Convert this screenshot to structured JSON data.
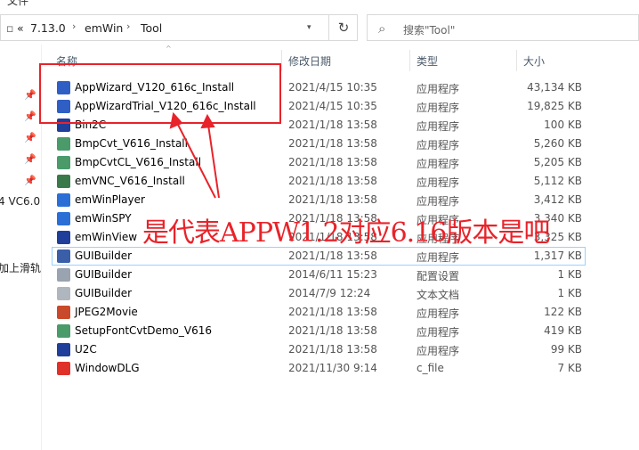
{
  "top_cut_text": "文件",
  "address": {
    "back_marker": "«",
    "crumbs": [
      "7.13.0",
      "emWin",
      "Tool"
    ],
    "refresh_icon": "refresh-icon"
  },
  "search": {
    "placeholder": "搜索\"Tool\""
  },
  "nav": {
    "items": [
      "4 VC6.0",
      "加上滑轨"
    ]
  },
  "columns": {
    "name": "名称",
    "date": "修改日期",
    "type": "类型",
    "size": "大小"
  },
  "files": [
    {
      "name": "AppWizard_V120_616c_Install",
      "date": "2021/4/15 10:35",
      "type": "应用程序",
      "size": "43,134 KB",
      "icon": "appwizard-icon",
      "color": "#2f5fc4"
    },
    {
      "name": "AppWizardTrial_V120_616c_Install",
      "date": "2021/4/15 10:35",
      "type": "应用程序",
      "size": "19,825 KB",
      "icon": "appwizard-icon",
      "color": "#2f5fc4"
    },
    {
      "name": "Bin2C",
      "date": "2021/1/18 13:58",
      "type": "应用程序",
      "size": "100 KB",
      "icon": "bin2c-icon",
      "color": "#1f3f9a"
    },
    {
      "name": "BmpCvt_V616_Install",
      "date": "2021/1/18 13:58",
      "type": "应用程序",
      "size": "5,260 KB",
      "icon": "installer-icon",
      "color": "#4a9a6a"
    },
    {
      "name": "BmpCvtCL_V616_Install",
      "date": "2021/1/18 13:58",
      "type": "应用程序",
      "size": "5,205 KB",
      "icon": "installer-icon",
      "color": "#4a9a6a"
    },
    {
      "name": "emVNC_V616_Install",
      "date": "2021/1/18 13:58",
      "type": "应用程序",
      "size": "5,112 KB",
      "icon": "installer-icon",
      "color": "#3a7a4a"
    },
    {
      "name": "emWinPlayer",
      "date": "2021/1/18 13:58",
      "type": "应用程序",
      "size": "3,412 KB",
      "icon": "player-icon",
      "color": "#2b6fd6"
    },
    {
      "name": "emWinSPY",
      "date": "2021/1/18 13:58",
      "type": "应用程序",
      "size": "3,340 KB",
      "icon": "spy-icon",
      "color": "#2b6fd6"
    },
    {
      "name": "emWinView",
      "date": "2021/1/18 13:58",
      "type": "应用程序",
      "size": "3,325 KB",
      "icon": "view-icon",
      "color": "#1f3f9a"
    },
    {
      "name": "GUIBuilder",
      "date": "2021/1/18 13:58",
      "type": "应用程序",
      "size": "1,317 KB",
      "icon": "guibuilder-icon",
      "color": "#3a5fa8",
      "selected": true
    },
    {
      "name": "GUIBuilder",
      "date": "2014/6/11 15:23",
      "type": "配置设置",
      "size": "1 KB",
      "icon": "config-file-icon",
      "color": "#9aa4b0"
    },
    {
      "name": "GUIBuilder",
      "date": "2014/7/9 12:24",
      "type": "文本文档",
      "size": "1 KB",
      "icon": "text-file-icon",
      "color": "#b0b6bd"
    },
    {
      "name": "JPEG2Movie",
      "date": "2021/1/18 13:58",
      "type": "应用程序",
      "size": "122 KB",
      "icon": "jpeg2movie-icon",
      "color": "#c94a2a"
    },
    {
      "name": "SetupFontCvtDemo_V616",
      "date": "2021/1/18 13:58",
      "type": "应用程序",
      "size": "419 KB",
      "icon": "installer-icon",
      "color": "#4a9a6a"
    },
    {
      "name": "U2C",
      "date": "2021/1/18 13:58",
      "type": "应用程序",
      "size": "99 KB",
      "icon": "u2c-icon",
      "color": "#1f3f9a"
    },
    {
      "name": "WindowDLG",
      "date": "2021/11/30 9:14",
      "type": "c_file",
      "size": "7 KB",
      "icon": "c-file-icon",
      "color": "#e0302a"
    }
  ],
  "annotation": {
    "text": "是代表APPW1.2对应6.16版本是吧",
    "color": "#e8232a"
  }
}
